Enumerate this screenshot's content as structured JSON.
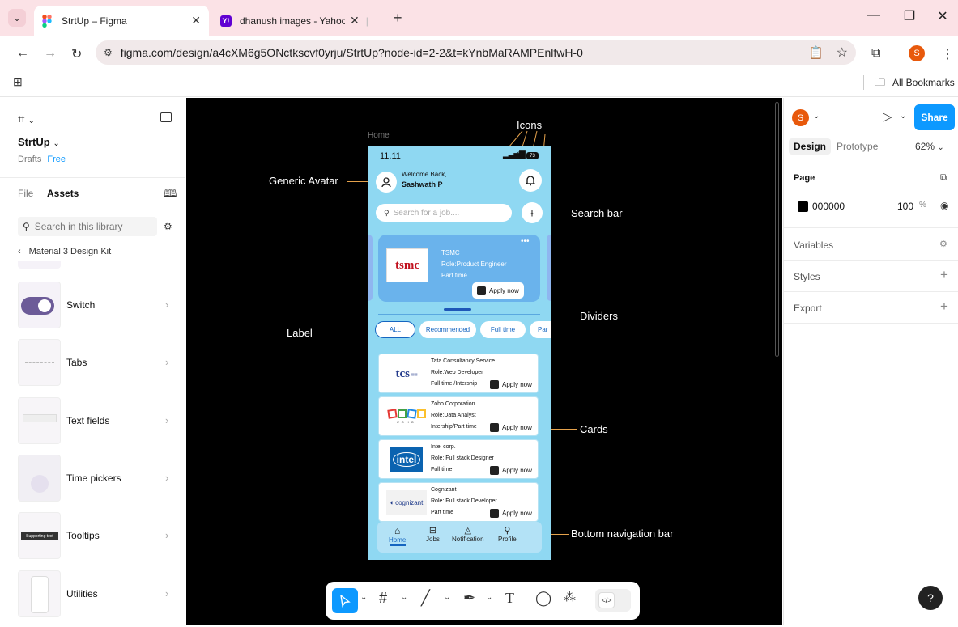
{
  "browser": {
    "tabs": [
      {
        "title": "StrtUp – Figma",
        "active": true
      },
      {
        "title": "dhanush images - Yahoo India I",
        "active": false
      }
    ],
    "url": "figma.com/design/a4cXM6g5ONctkscvf0yrju/StrtUp?node-id=2-2&t=kYnbMaRAMPEnlfwH-0",
    "bookmarks_label": "All Bookmarks",
    "profile_initial": "S"
  },
  "left_panel": {
    "file_name": "StrtUp",
    "drafts": "Drafts",
    "plan": "Free",
    "tab_file": "File",
    "tab_assets": "Assets",
    "search_placeholder": "Search in this library",
    "library": "Material 3 Design Kit",
    "assets": [
      {
        "label": "Switch"
      },
      {
        "label": "Tabs"
      },
      {
        "label": "Text fields"
      },
      {
        "label": "Time pickers"
      },
      {
        "label": "Tooltips"
      },
      {
        "label": "Utilities"
      }
    ],
    "tooltip_thumb_text": "Supporting text"
  },
  "canvas": {
    "frame_label": "Home",
    "annotations": {
      "icons": "Icons",
      "avatar": "Generic Avatar",
      "search": "Search bar",
      "dividers": "Dividers",
      "label": "Label",
      "cards": "Cards",
      "bottom_nav": "Bottom navigation bar"
    }
  },
  "phone": {
    "time": "11.11",
    "battery": "73",
    "welcome": "Welcome Back,",
    "user": "Sashwath P",
    "search_placeholder": "Search for a job....",
    "featured": {
      "company": "TSMC",
      "role": "Role:Product Engineer",
      "type": "Part time",
      "logo_text": "tsmc",
      "apply": "Apply now"
    },
    "chips": [
      "ALL",
      "Recommended",
      "Full time",
      "Par"
    ],
    "cards": [
      {
        "company": "Tata Consultancy Service",
        "role": "Role:Web Developer",
        "type": "Full time /Intership",
        "apply": "Apply now",
        "logo": "tcs"
      },
      {
        "company": "Zoho Corporation",
        "role": "Role:Data Analyst",
        "type": "Intership/Part time",
        "apply": "Apply now",
        "logo": "ZOHO"
      },
      {
        "company": "Intel corp.",
        "role": "Role: Full stack Designer",
        "type": "Full time",
        "apply": "Apply now",
        "logo": "intel"
      },
      {
        "company": "Cognizant",
        "role": "Role: Full stack Developer",
        "type": "Part time",
        "apply": "Apply now",
        "logo": "cognizant"
      }
    ],
    "bottom_nav": [
      "Home",
      "Jobs",
      "Notification",
      "Profile"
    ]
  },
  "right_panel": {
    "avatar_initial": "S",
    "share": "Share",
    "tab_design": "Design",
    "tab_prototype": "Prototype",
    "zoom": "62%",
    "page_label": "Page",
    "page_color": "000000",
    "page_opacity": "100",
    "opacity_unit": "%",
    "variables": "Variables",
    "styles": "Styles",
    "export": "Export",
    "help": "?"
  }
}
